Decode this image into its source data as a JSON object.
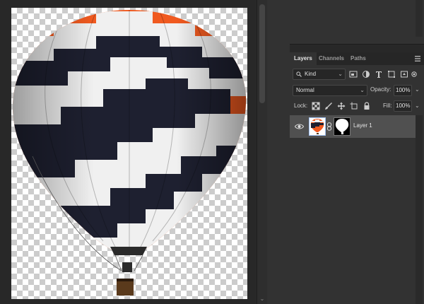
{
  "layers_panel": {
    "tabs": [
      {
        "label": "Layers",
        "active": true
      },
      {
        "label": "Channels",
        "active": false
      },
      {
        "label": "Paths",
        "active": false
      }
    ],
    "filter": {
      "kind_label": "Kind",
      "icons": [
        "pixel-filter-icon",
        "adjustment-filter-icon",
        "type-filter-icon",
        "shape-filter-icon",
        "smart-object-filter-icon",
        "filter-toggle-icon"
      ]
    },
    "blend_mode": "Normal",
    "opacity_label": "Opacity:",
    "opacity_value": "100%",
    "lock_label": "Lock:",
    "lock_icons": [
      "lock-transparent-icon",
      "lock-image-icon",
      "lock-position-icon",
      "lock-artboard-icon",
      "lock-all-icon"
    ],
    "fill_label": "Fill:",
    "fill_value": "100%",
    "layers": [
      {
        "name": "Layer 1",
        "visible": true,
        "selected": true
      }
    ]
  },
  "colors": {
    "ui_background": "#282828",
    "panel_background": "#323232",
    "selected_row": "#505050",
    "balloon_orange": "#f05a20",
    "balloon_navy": "#1e2030",
    "balloon_white": "#f0f0f0"
  }
}
